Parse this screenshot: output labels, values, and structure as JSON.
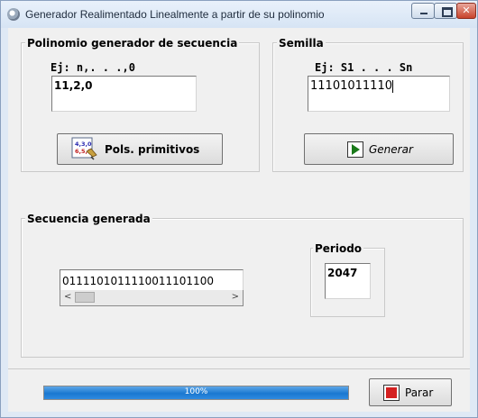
{
  "window": {
    "title": "Generador Realimentado Linealmente a partir de su polinomio"
  },
  "polinomio": {
    "legend": "Polinomio generador de secuencia",
    "hint": "Ej: n,. . .,0",
    "value": "11,2,0",
    "button_label": "Pols. primitivos"
  },
  "semilla": {
    "legend": "Semilla",
    "hint": "Ej: S1 . . . Sn",
    "value": "11101011110",
    "button_label": "Generar"
  },
  "secuencia": {
    "legend": "Secuencia generada",
    "value": "0111101011110011101100"
  },
  "periodo": {
    "legend": "Periodo",
    "value": "2047"
  },
  "progress": {
    "value": 100,
    "text": "100%"
  },
  "parar": {
    "button_label": "Parar"
  },
  "colors": {
    "accent": "#1a78d0",
    "stop_icon": "#d42020",
    "play_icon": "#1a7a1a"
  }
}
